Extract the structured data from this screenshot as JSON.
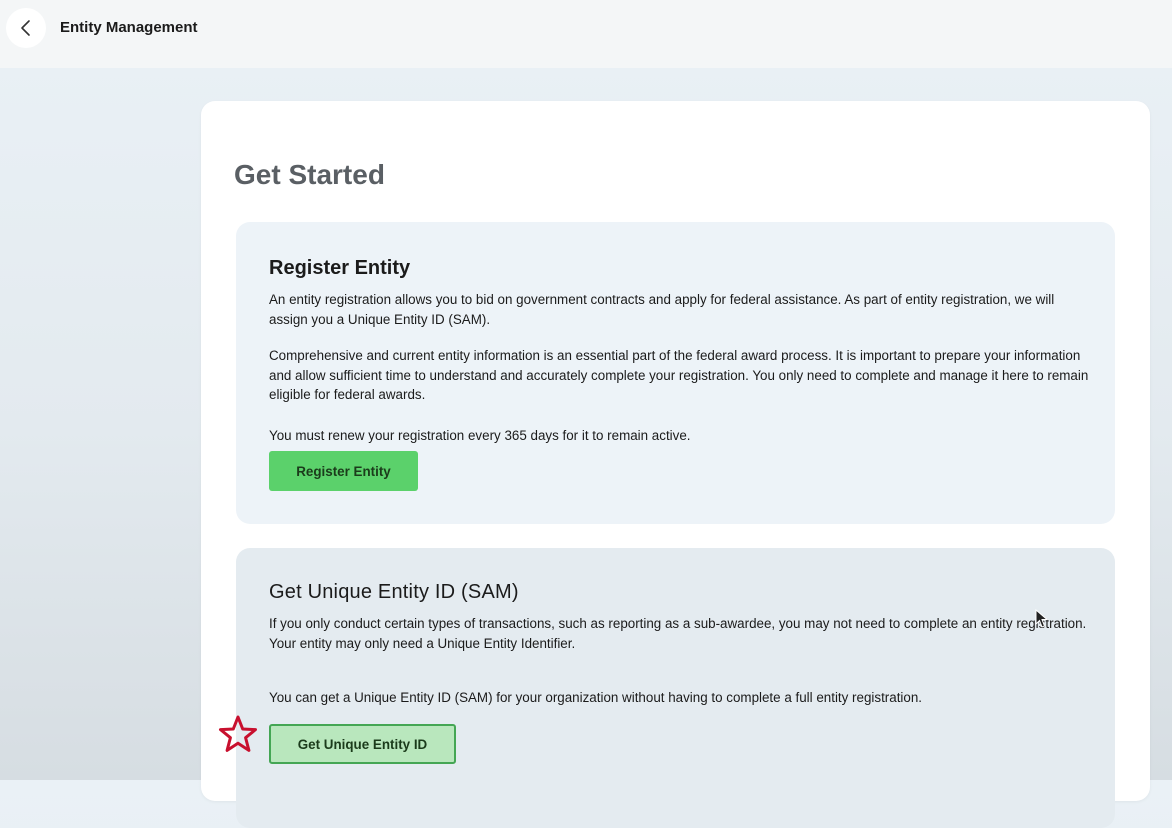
{
  "topbar": {
    "title": "Entity Management",
    "back_icon": "chevron-left-icon"
  },
  "main": {
    "title": "Get Started",
    "register_panel": {
      "heading": "Register Entity",
      "paragraphs": [
        "An entity registration allows you to bid on government contracts and apply for federal assistance. As part of entity registration, we will assign you a Unique Entity ID (SAM).",
        "Comprehensive and current entity information is an essential part of the federal award process. It is important to prepare your information and allow sufficient time to understand and accurately complete your registration. You only need to complete and manage it here to remain eligible for federal awards.",
        "You must renew your registration every 365 days for it to remain active."
      ],
      "button_label": "Register Entity"
    },
    "uei_panel": {
      "heading": "Get Unique Entity ID (SAM)",
      "paragraphs": [
        "If you only conduct certain types of transactions, such as reporting as a sub-awardee, you may not need to complete an entity registration. Your entity may only need a Unique Entity Identifier.",
        "You can get a Unique Entity ID (SAM) for your organization without having to complete a full entity registration."
      ],
      "button_label": "Get Unique Entity ID"
    }
  },
  "annotations": {
    "star_icon": "star-outline-icon",
    "star_color": "#c8102e"
  },
  "colors": {
    "primary_button": "#5bd16b",
    "secondary_button": "#b9e7bd",
    "secondary_button_border": "#44a654",
    "panel_background": "#edf3f8",
    "title_text": "#5a5f64"
  }
}
